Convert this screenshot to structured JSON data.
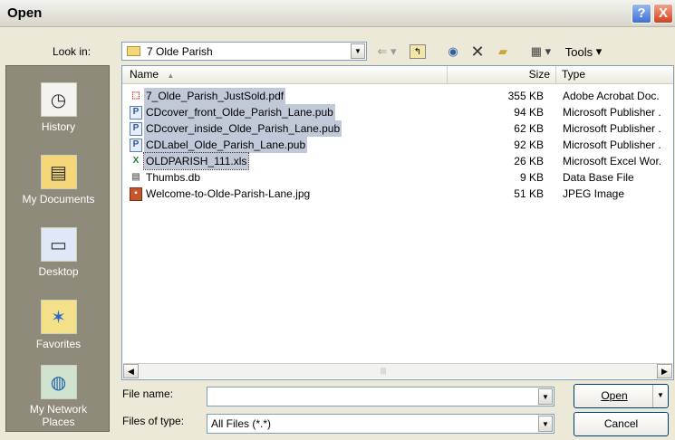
{
  "window": {
    "title": "Open",
    "help": "?",
    "close": "X"
  },
  "lookin": {
    "label": "Look in:",
    "value": "7 Olde Parish",
    "tools_label": "Tools"
  },
  "places": [
    {
      "label": "History"
    },
    {
      "label": "My Documents"
    },
    {
      "label": "Desktop"
    },
    {
      "label": "Favorites"
    },
    {
      "label": "My Network Places"
    }
  ],
  "columns": {
    "name": "Name",
    "size": "Size",
    "type": "Type"
  },
  "files": [
    {
      "name": "7_Olde_Parish_JustSold.pdf",
      "size": "355 KB",
      "type": "Adobe Acrobat Doc.",
      "icon": "pdf-icon",
      "selected": true
    },
    {
      "name": "CDcover_front_Olde_Parish_Lane.pub",
      "size": "94 KB",
      "type": "Microsoft Publisher .",
      "icon": "publisher-icon",
      "selected": true
    },
    {
      "name": "CDcover_inside_Olde_Parish_Lane.pub",
      "size": "62 KB",
      "type": "Microsoft Publisher .",
      "icon": "publisher-icon",
      "selected": true
    },
    {
      "name": "CDLabel_Olde_Parish_Lane.pub",
      "size": "92 KB",
      "type": "Microsoft Publisher .",
      "icon": "publisher-icon",
      "selected": true
    },
    {
      "name": "OLDPARISH_111.xls",
      "size": "26 KB",
      "type": "Microsoft Excel Wor.",
      "icon": "excel-icon",
      "selected": true
    },
    {
      "name": "Thumbs.db",
      "size": "9 KB",
      "type": "Data Base File",
      "icon": "database-icon",
      "selected": false
    },
    {
      "name": "Welcome-to-Olde-Parish-Lane.jpg",
      "size": "51 KB",
      "type": "JPEG Image",
      "icon": "image-icon",
      "selected": false
    }
  ],
  "filename": {
    "label": "File name:",
    "value": ""
  },
  "filetype": {
    "label": "Files of type:",
    "value": "All Files (*.*)"
  },
  "buttons": {
    "open": "Open",
    "cancel": "Cancel"
  }
}
